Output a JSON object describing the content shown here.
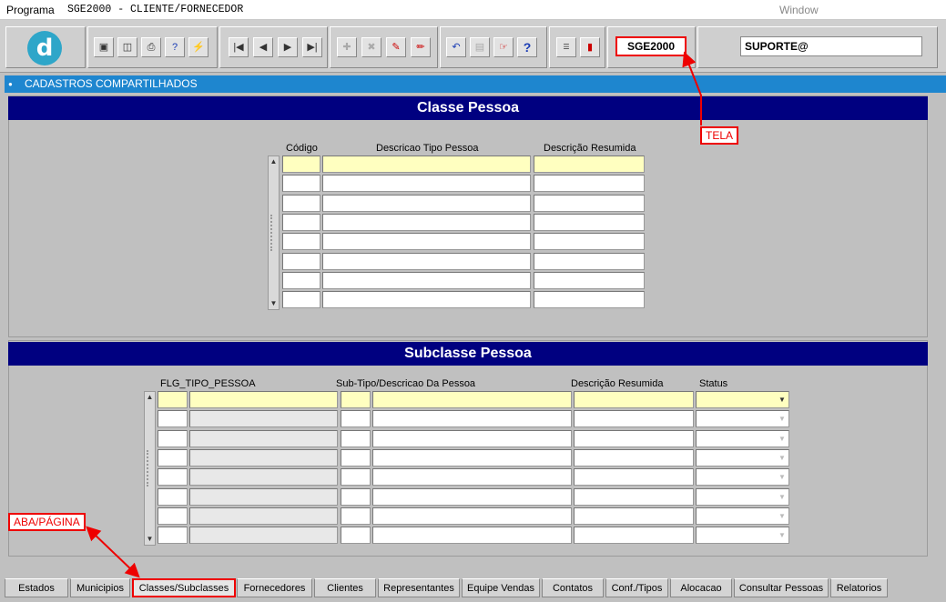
{
  "menubar": {
    "program": "Programa",
    "title": "SGE2000 - CLIENTE/FORNECEDOR",
    "window": "Window"
  },
  "toolbar": {
    "logo": "d",
    "buttons": [
      "save-icon",
      "window-icon",
      "print-icon",
      "help-query-icon",
      "query-run-icon",
      "first-record-icon",
      "prev-record-icon",
      "next-record-icon",
      "last-record-icon",
      "insert-record-icon",
      "delete-record-icon",
      "edit-record-icon",
      "pen-icon",
      "undo-icon",
      "clipboard-icon",
      "hand-icon",
      "help-icon",
      "menu-icon",
      "exit-icon"
    ],
    "screen_name": "SGE2000",
    "user": "SUPORTE@"
  },
  "bluebar": {
    "title": "CADASTROS COMPARTILHADOS"
  },
  "classe": {
    "header": "Classe Pessoa",
    "columns": {
      "codigo": "Código",
      "descricao": "Descricao Tipo Pessoa",
      "resumida": "Descrição Resumida"
    }
  },
  "subclasse": {
    "header": "Subclasse Pessoa",
    "columns": {
      "flg": "FLG_TIPO_PESSOA",
      "subtipo": "Sub-Tipo/Descricao Da Pessoa",
      "resumida": "Descrição Resumida",
      "status": "Status"
    }
  },
  "annotations": {
    "tela": "TELA",
    "aba": "ABA/PÁGINA"
  },
  "tabs": [
    "Estados",
    "Municipios",
    "Classes/Subclasses",
    "Fornecedores",
    "Clientes",
    "Representantes",
    "Equipe Vendas",
    "Contatos",
    "Conf./Tipos",
    "Alocacao",
    "Consultar Pessoas",
    "Relatorios"
  ],
  "active_tab": "Classes/Subclasses",
  "colors": {
    "accent": "#1e86cf",
    "header": "#000080",
    "highlight": "#ff0000"
  }
}
